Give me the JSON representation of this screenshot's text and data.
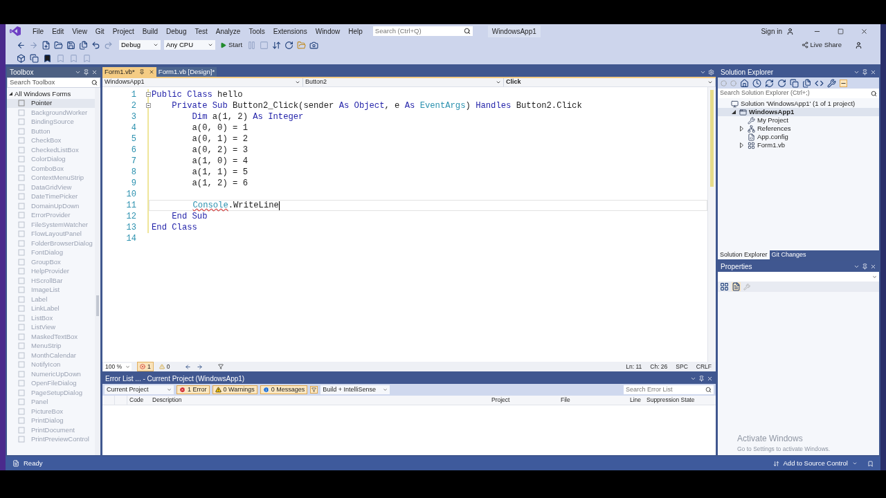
{
  "menu_bar": {
    "items": [
      "File",
      "Edit",
      "View",
      "Git",
      "Project",
      "Build",
      "Debug",
      "Test",
      "Analyze",
      "Tools",
      "Extensions",
      "Window",
      "Help"
    ],
    "search": {
      "placeholder": "Search (Ctrl+Q)"
    },
    "solution_name": "WindowsApp1",
    "sign_in": "Sign in"
  },
  "toolbar": {
    "configuration": "Debug",
    "platform": "Any CPU",
    "start": "Start",
    "live_share": "Live Share"
  },
  "toolbox": {
    "title": "Toolbox",
    "search": {
      "placeholder": "Search Toolbox"
    },
    "group": {
      "label": "All Windows Forms",
      "expanded": true
    },
    "items": [
      {
        "label": "Pointer",
        "selected": true
      },
      {
        "label": "BackgroundWorker",
        "selected": false
      },
      {
        "label": "BindingSource",
        "selected": false
      },
      {
        "label": "Button",
        "selected": false
      },
      {
        "label": "CheckBox",
        "selected": false
      },
      {
        "label": "CheckedListBox",
        "selected": false
      },
      {
        "label": "ColorDialog",
        "selected": false
      },
      {
        "label": "ComboBox",
        "selected": false
      },
      {
        "label": "ContextMenuStrip",
        "selected": false
      },
      {
        "label": "DataGridView",
        "selected": false
      },
      {
        "label": "DateTimePicker",
        "selected": false
      },
      {
        "label": "DomainUpDown",
        "selected": false
      },
      {
        "label": "ErrorProvider",
        "selected": false
      },
      {
        "label": "FileSystemWatcher",
        "selected": false
      },
      {
        "label": "FlowLayoutPanel",
        "selected": false
      },
      {
        "label": "FolderBrowserDialog",
        "selected": false
      },
      {
        "label": "FontDialog",
        "selected": false
      },
      {
        "label": "GroupBox",
        "selected": false
      },
      {
        "label": "HelpProvider",
        "selected": false
      },
      {
        "label": "HScrollBar",
        "selected": false
      },
      {
        "label": "ImageList",
        "selected": false
      },
      {
        "label": "Label",
        "selected": false
      },
      {
        "label": "LinkLabel",
        "selected": false
      },
      {
        "label": "ListBox",
        "selected": false
      },
      {
        "label": "ListView",
        "selected": false
      },
      {
        "label": "MaskedTextBox",
        "selected": false
      },
      {
        "label": "MenuStrip",
        "selected": false
      },
      {
        "label": "MonthCalendar",
        "selected": false
      },
      {
        "label": "NotifyIcon",
        "selected": false
      },
      {
        "label": "NumericUpDown",
        "selected": false
      },
      {
        "label": "OpenFileDialog",
        "selected": false
      },
      {
        "label": "PageSetupDialog",
        "selected": false
      },
      {
        "label": "Panel",
        "selected": false
      },
      {
        "label": "PictureBox",
        "selected": false
      },
      {
        "label": "PrintDialog",
        "selected": false
      },
      {
        "label": "PrintDocument",
        "selected": false
      },
      {
        "label": "PrintPreviewControl",
        "selected": false
      }
    ]
  },
  "editor": {
    "tabs": [
      {
        "label": "Form1.vb*",
        "selected": true
      },
      {
        "label": "Form1.vb [Design]*",
        "selected": false
      }
    ],
    "navigation": [
      "WindowsApp1",
      "Button2",
      "Click"
    ],
    "lines": [
      {
        "number": "1",
        "fold": true,
        "current": false,
        "tokens": [
          {
            "kind": "keyword",
            "text": "Public Class "
          },
          {
            "kind": "plain",
            "text": "hello"
          }
        ]
      },
      {
        "number": "2",
        "fold": true,
        "current": false,
        "tokens": [
          {
            "kind": "keyword",
            "text": "    Private Sub "
          },
          {
            "kind": "plain",
            "text": "Button2_Click(sender "
          },
          {
            "kind": "keyword",
            "text": "As Object"
          },
          {
            "kind": "plain",
            "text": ", e "
          },
          {
            "kind": "keyword",
            "text": "As "
          },
          {
            "kind": "type",
            "text": "EventArgs"
          },
          {
            "kind": "plain",
            "text": ") "
          },
          {
            "kind": "keyword",
            "text": "Handles "
          },
          {
            "kind": "plain",
            "text": "Button2.Click"
          }
        ]
      },
      {
        "number": "3",
        "fold": false,
        "current": false,
        "tokens": [
          {
            "kind": "keyword",
            "text": "        Dim "
          },
          {
            "kind": "plain",
            "text": "a(1, 2) "
          },
          {
            "kind": "keyword",
            "text": "As Integer"
          }
        ]
      },
      {
        "number": "4",
        "fold": false,
        "current": false,
        "tokens": [
          {
            "kind": "plain",
            "text": "        a(0, 0) = 1"
          }
        ]
      },
      {
        "number": "5",
        "fold": false,
        "current": false,
        "tokens": [
          {
            "kind": "plain",
            "text": "        a(0, 1) = 2"
          }
        ]
      },
      {
        "number": "6",
        "fold": false,
        "current": false,
        "tokens": [
          {
            "kind": "plain",
            "text": "        a(0, 2) = 3"
          }
        ]
      },
      {
        "number": "7",
        "fold": false,
        "current": false,
        "tokens": [
          {
            "kind": "plain",
            "text": "        a(1, 0) = 4"
          }
        ]
      },
      {
        "number": "8",
        "fold": false,
        "current": false,
        "tokens": [
          {
            "kind": "plain",
            "text": "        a(1, 1) = 5"
          }
        ]
      },
      {
        "number": "9",
        "fold": false,
        "current": false,
        "tokens": [
          {
            "kind": "plain",
            "text": "        a(1, 2) = 6"
          }
        ]
      },
      {
        "number": "10",
        "fold": false,
        "current": false
      },
      {
        "number": "11",
        "fold": false,
        "current": true,
        "tokens": [
          {
            "kind": "error_type",
            "text": "        Console"
          },
          {
            "kind": "plain",
            "text": ".WriteLine"
          }
        ]
      },
      {
        "number": "12",
        "fold": false,
        "current": false,
        "tokens": [
          {
            "kind": "keyword",
            "text": "    End Sub"
          }
        ]
      },
      {
        "number": "13",
        "fold": false,
        "current": false,
        "tokens": [
          {
            "kind": "keyword",
            "text": "End Class"
          }
        ]
      },
      {
        "number": "14",
        "fold": false,
        "current": false
      }
    ],
    "status": {
      "zoom": "100 %",
      "errors": "1",
      "warnings": "0",
      "line": "Ln: 11",
      "column": "Ch: 26",
      "spacing": "SPC",
      "line_ending": "CRLF"
    }
  },
  "error_list": {
    "title": "Error List ... - Current Project (WindowsApp1)",
    "scope": "Current Project",
    "filters": [
      {
        "kind": "error",
        "label": "1 Error",
        "selected": true
      },
      {
        "kind": "warning",
        "label": "0 Warnings",
        "selected": true
      },
      {
        "kind": "message",
        "label": "0 Messages",
        "selected": true
      }
    ],
    "source": "Build + IntelliSense",
    "search": {
      "placeholder": "Search Error List"
    },
    "columns": [
      "Code",
      "Description",
      "Project",
      "File",
      "Line",
      "Suppression State"
    ]
  },
  "solution_explorer": {
    "title": "Solution Explorer",
    "search": {
      "placeholder": "Search Solution Explorer (Ctrl+;)"
    },
    "tree": [
      {
        "label": "Solution 'WindowsApp1' (1 of 1 project)",
        "kind": "solution",
        "selected": false,
        "children": [
          {
            "label": "WindowsApp1",
            "kind": "project",
            "selected": true,
            "expanded": true,
            "children": [
              {
                "label": "My Project",
                "kind": "settings",
                "selected": false
              },
              {
                "label": "References",
                "kind": "references",
                "selected": false,
                "expanded": false
              },
              {
                "label": "App.config",
                "kind": "config",
                "selected": false
              },
              {
                "label": "Form1.vb",
                "kind": "form",
                "selected": false,
                "expanded": false
              }
            ]
          }
        ]
      }
    ],
    "tabs": [
      {
        "label": "Solution Explorer",
        "selected": true
      },
      {
        "label": "Git Changes",
        "selected": false
      }
    ]
  },
  "properties": {
    "title": "Properties"
  },
  "activation": {
    "title": "Activate Windows",
    "hint": "Go to Settings to activate Windows."
  },
  "status_bar": {
    "text": "Ready",
    "source_control": "Add to Source Control"
  }
}
